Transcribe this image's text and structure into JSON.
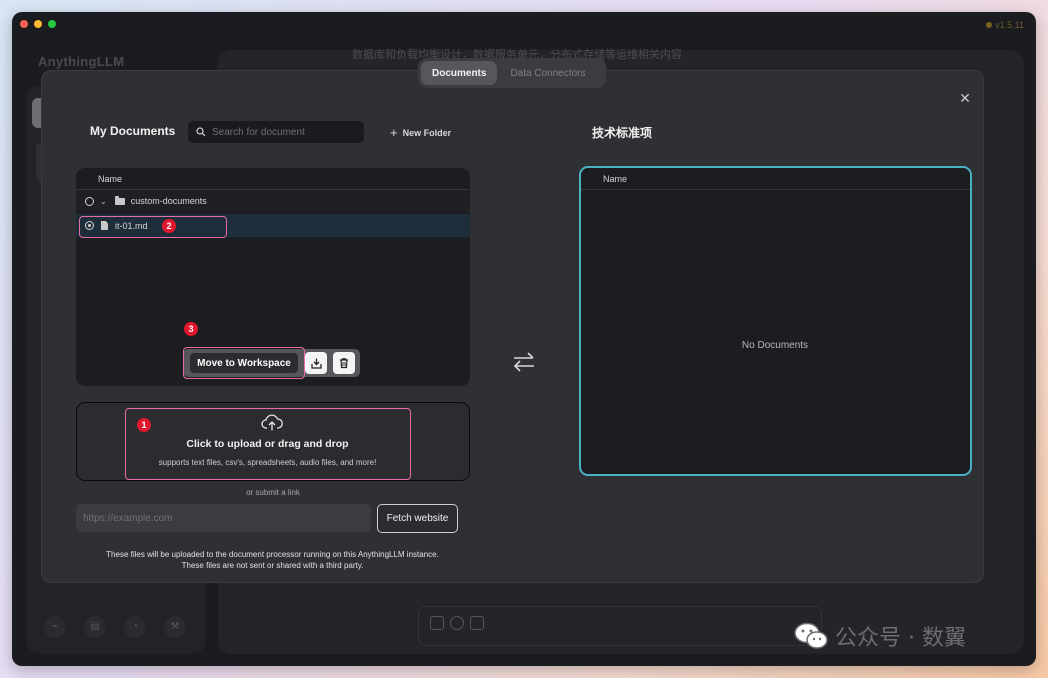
{
  "app": {
    "name": "AnythingLLM",
    "version": "v1.5.11",
    "chat_line": "数据库和负载均衡设计，数据服务单元，分布式存储等运维相关内容"
  },
  "tabs": [
    {
      "label": "Documents",
      "active": true
    },
    {
      "label": "Data Connectors",
      "active": false
    }
  ],
  "left": {
    "title": "My Documents",
    "search_placeholder": "Search for document",
    "new_folder_label": "New Folder",
    "column_name": "Name",
    "folder_name": "custom-documents",
    "file_name": "it-01.md",
    "move_button": "Move to Workspace"
  },
  "upload": {
    "title": "Click to upload or drag and drop",
    "subtitle": "supports text files, csv's, spreadsheets, audio files, and more!",
    "or_link": "or submit a link",
    "url_placeholder": "https://example.com",
    "fetch_button": "Fetch website",
    "disclaimer_line1": "These files will be uploaded to the document processor running on this AnythingLLM instance.",
    "disclaimer_line2": "These files are not sent or shared with a third party."
  },
  "right": {
    "title": "技术标准项",
    "column_name": "Name",
    "empty_text": "No Documents"
  },
  "annotations": [
    "1",
    "2",
    "3"
  ],
  "watermark": "公众号 · 数翼",
  "colors": {
    "accent_border": "#4ab1c4",
    "annotation_box": "#e86aa8",
    "annotation_badge": "#e0172e",
    "selected_row": "#1e2d3a"
  }
}
